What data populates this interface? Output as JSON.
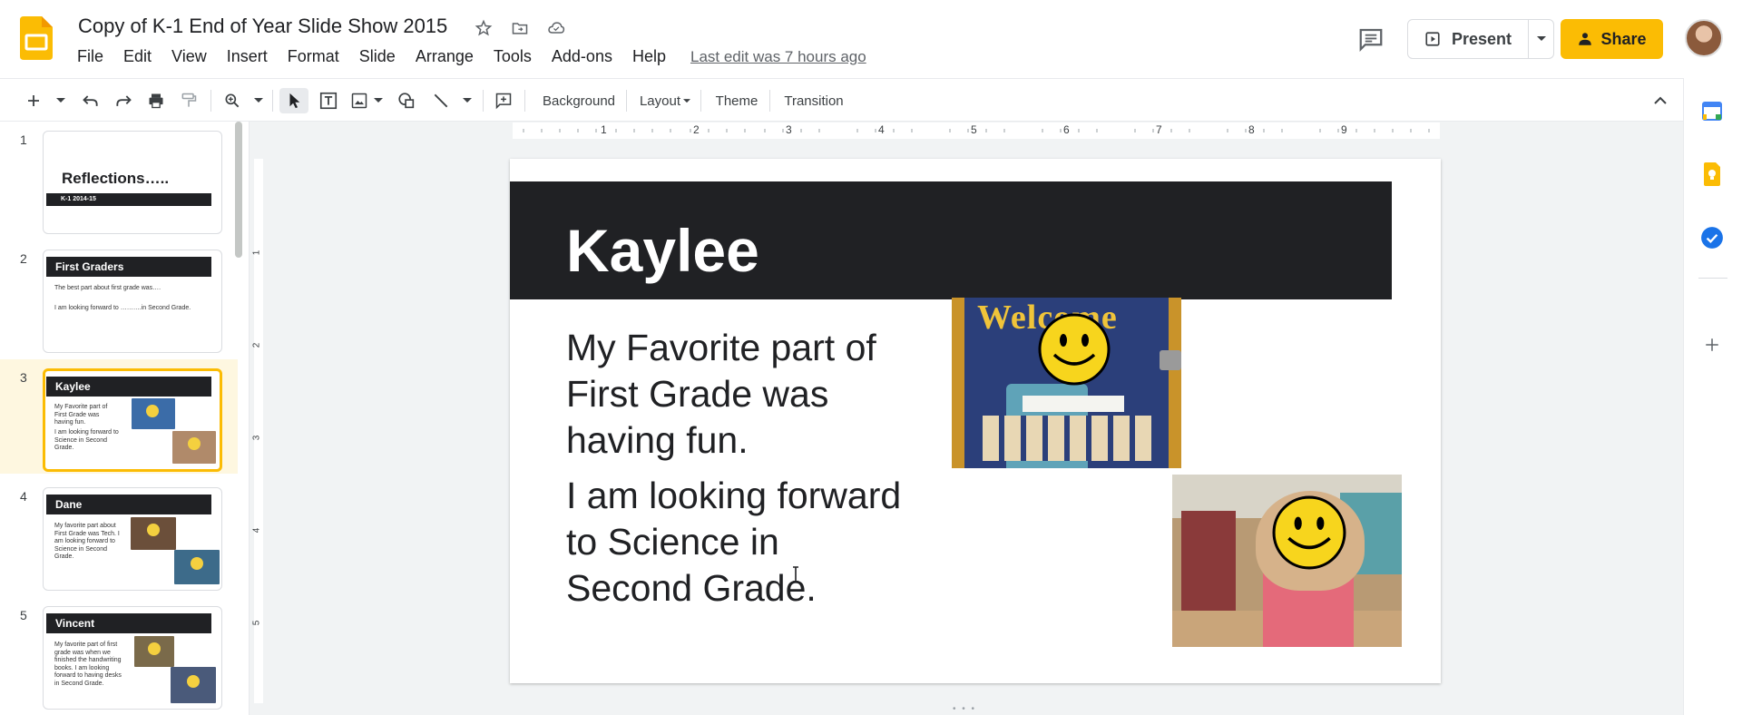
{
  "app": {
    "doc_title": "Copy of K-1 End of Year Slide Show 2015",
    "last_edit": "Last edit was 7 hours ago"
  },
  "menu": [
    "File",
    "Edit",
    "View",
    "Insert",
    "Format",
    "Slide",
    "Arrange",
    "Tools",
    "Add-ons",
    "Help"
  ],
  "header": {
    "present_label": "Present",
    "share_label": "Share"
  },
  "toolbar": {
    "background_label": "Background",
    "layout_label": "Layout",
    "theme_label": "Theme",
    "transition_label": "Transition"
  },
  "ruler": {
    "horizontal": [
      "1",
      "2",
      "3",
      "4",
      "5",
      "6",
      "7",
      "8",
      "9"
    ],
    "vertical": [
      "1",
      "2",
      "3",
      "4",
      "5"
    ]
  },
  "filmstrip": {
    "slides": [
      {
        "number": "1",
        "title": "Reflections…..",
        "subtitle": "K-1 2014-15"
      },
      {
        "number": "2",
        "title": "First Graders",
        "body": [
          "The best part about first grade was….",
          "I am looking forward to ……….in Second Grade."
        ]
      },
      {
        "number": "3",
        "title": "Kaylee",
        "body": [
          "My Favorite part of First Grade was having fun.",
          "I am looking forward to Science in Second Grade."
        ]
      },
      {
        "number": "4",
        "title": "Dane",
        "body": [
          "My favorite part about First Grade was Tech. I am looking forward to Science in Second Grade."
        ]
      },
      {
        "number": "5",
        "title": "Vincent",
        "body": [
          "My favorite part of first grade was when we finished the handwriting books. I am looking forward to having desks in Second Grade."
        ]
      }
    ]
  },
  "slide": {
    "title": "Kaylee",
    "para1": [
      "My Favorite part of",
      "First Grade was",
      "having fun."
    ],
    "para2": [
      "I am looking forward",
      "to Science in",
      "Second Grade."
    ],
    "photo1_sign": "Welcome"
  },
  "colors": {
    "accent": "#fbbc04",
    "title_bar": "#202124",
    "canvas_bg": "#f1f3f4"
  }
}
